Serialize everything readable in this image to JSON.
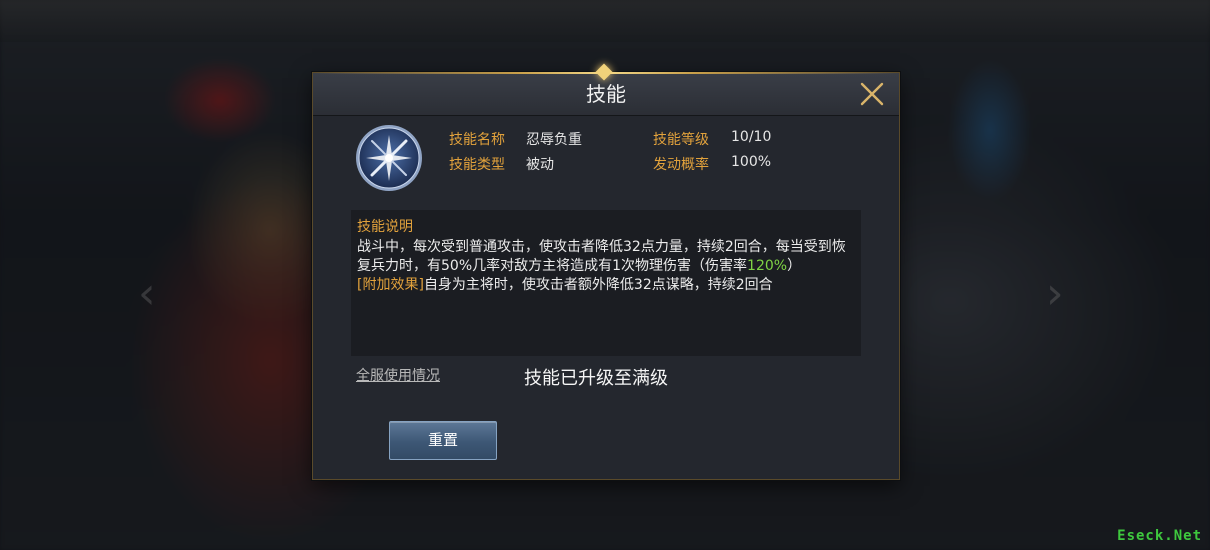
{
  "dialog": {
    "title": "技能",
    "close_icon": "close-icon"
  },
  "skill": {
    "icon": "crossed-swords-icon",
    "name_label": "技能名称",
    "name_value": "忍辱负重",
    "level_label": "技能等级",
    "level_value": "10/10",
    "type_label": "技能类型",
    "type_value": "被动",
    "rate_label": "发动概率",
    "rate_value": "100%"
  },
  "description": {
    "title": "技能说明",
    "text_part1": "战斗中，每次受到普通攻击，使攻击者降低32点力量，持续2回合，每当受到恢复兵力时，有50%几率对敌方主将造成有1次物理伤害（伤害率",
    "text_highlight": "120%",
    "text_part2": "）",
    "extra_label": "[附加效果]",
    "extra_text": "自身为主将时，使攻击者额外降低32点谋略，持续2回合"
  },
  "usage_link": "全服使用情况",
  "status_text": "技能已升级至满级",
  "reset_button": "重置",
  "watermark": "Eseck.Net",
  "colors": {
    "label_gold": "#e2a23c",
    "highlight_green": "#7fd445",
    "button_blue": "#3d5775",
    "watermark_green": "#3ec83e"
  }
}
